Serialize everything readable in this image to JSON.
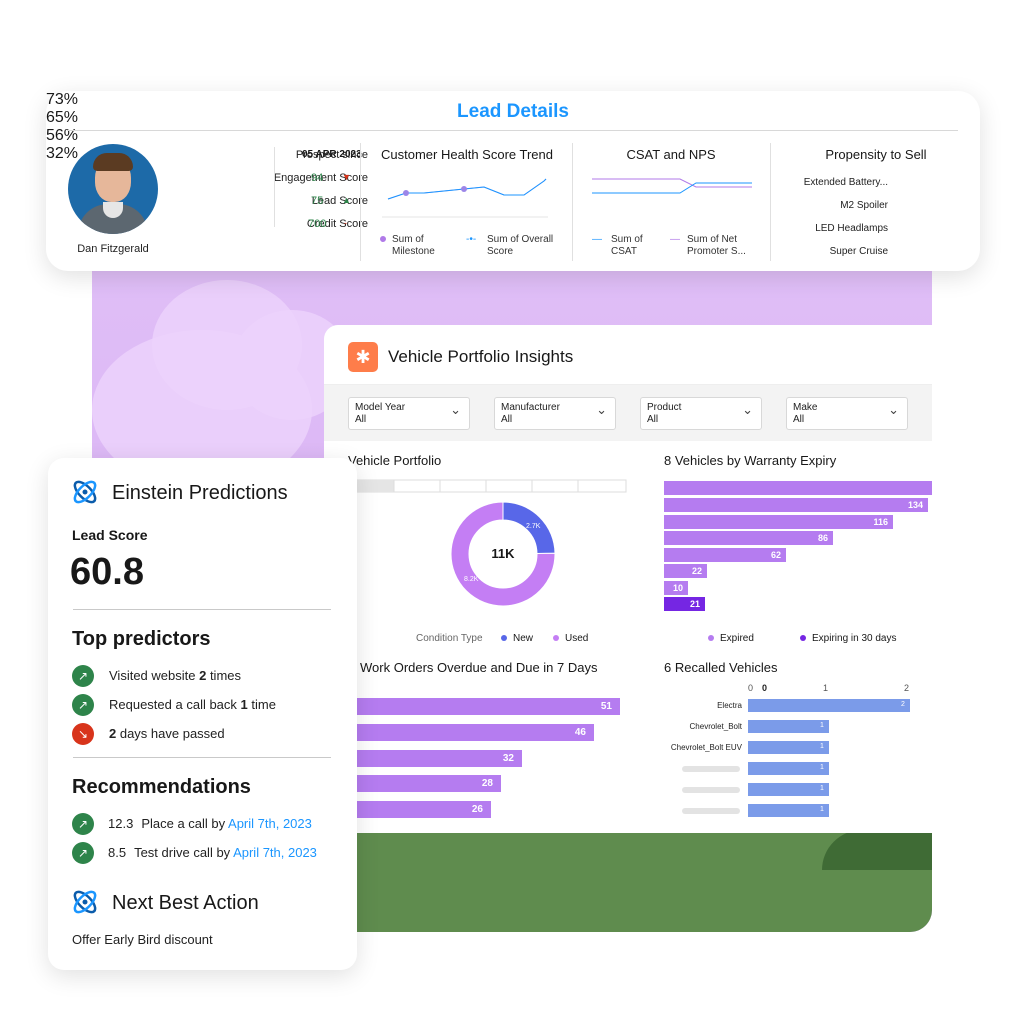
{
  "lead_details": {
    "title": "Lead Details",
    "person_name": "Dan Fitzgerald",
    "scores": [
      {
        "label": "Prospect since",
        "value": "05 APR 2023",
        "trend": ""
      },
      {
        "label": "Engagement Score",
        "value": "94",
        "trend": "down"
      },
      {
        "label": "Lead Score",
        "value": "75",
        "trend": "up"
      },
      {
        "label": "Credit Score",
        "value": "700",
        "trend": "flat"
      }
    ],
    "health_trend": {
      "title": "Customer Health Score Trend",
      "legend": [
        "Sum of Milestone",
        "Sum of Overall Score"
      ]
    },
    "csat_nps": {
      "title": "CSAT and NPS",
      "legend": [
        "Sum of CSAT",
        "Sum of Net Promoter S..."
      ]
    },
    "propensity": {
      "title": "Propensity to Sell",
      "rows": [
        {
          "label": "Extended Battery...",
          "value": "73%",
          "pct": 73
        },
        {
          "label": "M2 Spoiler",
          "value": "65%",
          "pct": 65
        },
        {
          "label": "LED Headlamps",
          "value": "56%",
          "pct": 56
        },
        {
          "label": "Super Cruise",
          "value": "32%",
          "pct": 32
        }
      ]
    }
  },
  "vehicle_insights": {
    "title": "Vehicle Portfolio Insights",
    "filters": [
      {
        "label": "Model Year",
        "value": "All"
      },
      {
        "label": "Manufacturer",
        "value": "All"
      },
      {
        "label": "Product",
        "value": "All"
      },
      {
        "label": "Make",
        "value": "All"
      }
    ],
    "portfolio": {
      "title": "Vehicle Portfolio",
      "total": "11K",
      "new_label": "2.7K",
      "used_label": "8.2K",
      "legend_title": "Condition Type",
      "legend": [
        "New",
        "Used"
      ]
    },
    "warranty": {
      "title": "8 Vehicles by Warranty Expiry",
      "legend": [
        "Expired",
        "Expiring in 30 days"
      ]
    },
    "work_orders": {
      "title": "Work Orders Overdue and Due in 7 Days"
    },
    "recalled": {
      "title": "6 Recalled Vehicles",
      "ticks": [
        "0",
        "0",
        "1",
        "2"
      ],
      "labels": [
        "Electra",
        "Chevrolet_Bolt",
        "Chevrolet_Bolt EUV"
      ]
    }
  },
  "chart_data": [
    {
      "type": "pie",
      "title": "Vehicle Portfolio",
      "categories": [
        "New",
        "Used"
      ],
      "values": [
        2700,
        8200
      ]
    },
    {
      "type": "bar",
      "title": "8 Vehicles by Warranty Expiry",
      "series": [
        {
          "name": "Expired",
          "values": [
            134,
            116,
            86,
            62,
            22,
            10
          ]
        },
        {
          "name": "Expiring in 30 days",
          "values": [
            21
          ]
        }
      ]
    },
    {
      "type": "bar",
      "title": "Work Orders Overdue and Due in 7 Days",
      "values": [
        51,
        46,
        32,
        28,
        26
      ]
    },
    {
      "type": "bar",
      "title": "6 Recalled Vehicles",
      "categories": [
        "Electra",
        "Chevrolet_Bolt",
        "Chevrolet_Bolt EUV",
        "",
        "",
        ""
      ],
      "values": [
        2,
        1,
        1,
        1,
        1,
        1
      ],
      "xlim": [
        0,
        2
      ]
    }
  ],
  "einstein": {
    "title": "Einstein Predictions",
    "lead_score_label": "Lead Score",
    "lead_score": "60.8",
    "predictors_heading": "Top predictors",
    "predictors": [
      {
        "pre": "Visited website ",
        "bold": "2",
        "post": " times",
        "dir": "up"
      },
      {
        "pre": "Requested a call back ",
        "bold": "1",
        "post": " time",
        "dir": "up"
      },
      {
        "pre": "",
        "bold": "2",
        "post": " days have passed",
        "dir": "down"
      }
    ],
    "recommendations_heading": "Recommendations",
    "recommendations": [
      {
        "score": "12.3",
        "text": "Place a call by ",
        "date": "April 7th, 2023"
      },
      {
        "score": "8.5",
        "text": "Test drive call by ",
        "date": "April 7th, 2023"
      }
    ],
    "nba_title": "Next Best Action",
    "nba_offer": "Offer Early Bird discount"
  },
  "colors": {
    "accent": "#1b96ff",
    "bar_purple": "#b57cf0",
    "dark_purple": "#7526e3",
    "donut_new": "#5867e8",
    "donut_used": "#c47ef4",
    "recall_blue": "#7b9be9",
    "positive": "#2e844a",
    "negative": "#d8341b"
  }
}
